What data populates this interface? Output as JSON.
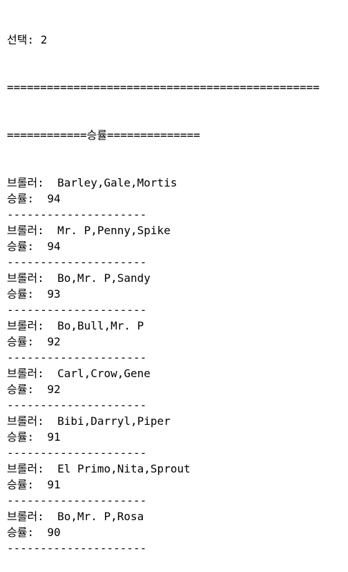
{
  "console": {
    "selection_line": "선택: 2",
    "top_rule": "===============================================",
    "header_line": "============승률==============",
    "brawlers_label": "브롤러:",
    "winrate_label": "승률:",
    "separator": "---------------------",
    "entries": [
      {
        "brawlers": "Barley,Gale,Mortis",
        "winrate": "94"
      },
      {
        "brawlers": "Mr. P,Penny,Spike",
        "winrate": "94"
      },
      {
        "brawlers": "Bo,Mr. P,Sandy",
        "winrate": "93"
      },
      {
        "brawlers": "Bo,Bull,Mr. P",
        "winrate": "92"
      },
      {
        "brawlers": "Carl,Crow,Gene",
        "winrate": "92"
      },
      {
        "brawlers": "Bibi,Darryl,Piper",
        "winrate": "91"
      },
      {
        "brawlers": "El Primo,Nita,Sprout",
        "winrate": "91"
      },
      {
        "brawlers": "Bo,Mr. P,Rosa",
        "winrate": "90"
      }
    ]
  }
}
